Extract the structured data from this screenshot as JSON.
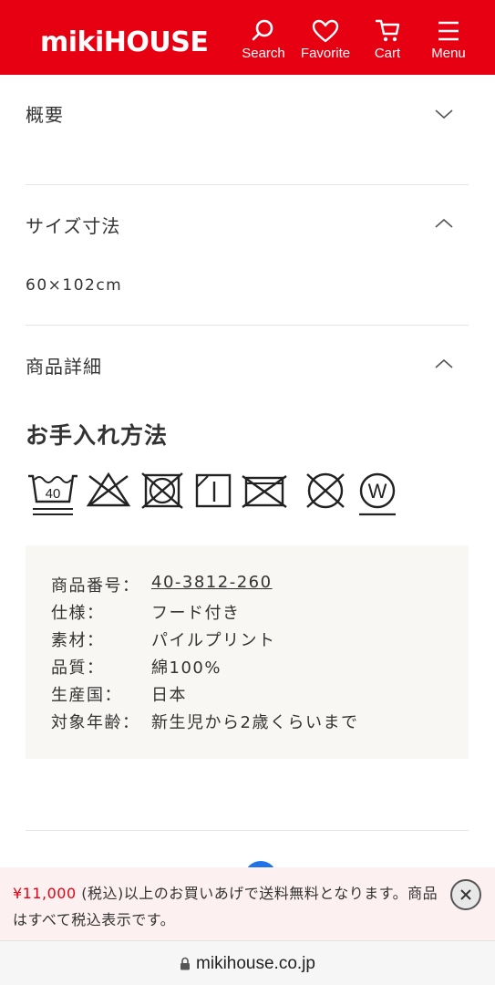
{
  "header": {
    "logo": "mikiHOUSE",
    "brand_color": "#e60012",
    "nav": [
      {
        "label": "Search",
        "icon": "search-icon"
      },
      {
        "label": "Favorite",
        "icon": "heart-icon"
      },
      {
        "label": "Cart",
        "icon": "cart-icon"
      },
      {
        "label": "Menu",
        "icon": "menu-icon"
      }
    ]
  },
  "sections": {
    "overview": {
      "title": "概要",
      "state": "collapsed",
      "icon": "chevron-down-icon"
    },
    "size": {
      "title": "サイズ寸法",
      "state": "expanded",
      "icon": "chevron-up-icon",
      "value": "60×102cm"
    },
    "details": {
      "title": "商品詳細",
      "state": "expanded",
      "icon": "chevron-up-icon"
    }
  },
  "care": {
    "title": "お手入れ方法",
    "icons": [
      "wash-40-gentle-icon",
      "no-bleach-icon",
      "no-tumble-dry-icon",
      "line-dry-shade-icon",
      "no-iron-icon",
      "no-dry-clean-icon",
      "wet-clean-gentle-icon"
    ],
    "wash_temp": "40",
    "wet_letter": "W"
  },
  "specs": [
    {
      "key": "商品番号：",
      "value": "40-3812-260",
      "link": true
    },
    {
      "key": "仕様：",
      "value": "フード付き",
      "link": false
    },
    {
      "key": "素材：",
      "value": "パイルプリント",
      "link": false
    },
    {
      "key": "品質：",
      "value": "綿100%",
      "link": false
    },
    {
      "key": "生産国：",
      "value": "日本",
      "link": false
    },
    {
      "key": "対象年齢：",
      "value": "新生児から2歳くらいまで",
      "link": false
    }
  ],
  "notice": {
    "price": "¥11,000",
    "text": " (税込)以上のお買いあげで送料無料となります。商品はすべて税込表示です。",
    "accent_color": "#e60012"
  },
  "urlbar": {
    "url": "mikihouse.co.jp",
    "icon": "lock-icon"
  }
}
